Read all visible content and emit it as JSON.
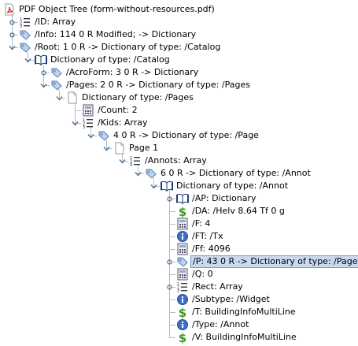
{
  "colors": {
    "tree_line": "#a9c0d8",
    "selection_bg": "#c9d9ee",
    "selection_border": "#7a9cc6"
  },
  "nodes": [
    {
      "label": "PDF Object Tree (form-without-resources.pdf)",
      "icon": "pdf-icon",
      "depth": 0,
      "handle": "none"
    },
    {
      "label": "/ID: Array",
      "icon": "array-icon",
      "depth": 1,
      "handle": "collapsed"
    },
    {
      "label": "/Info: 114 0 R Modified; -> Dictionary",
      "icon": "tag-icon",
      "depth": 1,
      "handle": "collapsed"
    },
    {
      "label": "/Root: 1 0 R -> Dictionary of type: /Catalog",
      "icon": "tag-icon",
      "depth": 1,
      "handle": "expanded"
    },
    {
      "label": "Dictionary of type: /Catalog",
      "icon": "dictionary-icon",
      "depth": 2,
      "handle": "expanded"
    },
    {
      "label": "/AcroForm: 3 0 R -> Dictionary",
      "icon": "tag-icon",
      "depth": 3,
      "handle": "collapsed"
    },
    {
      "label": "/Pages: 2 0 R -> Dictionary of type: /Pages",
      "icon": "tag-icon",
      "depth": 3,
      "handle": "expanded"
    },
    {
      "label": "Dictionary of type: /Pages",
      "icon": "page-icon",
      "depth": 4,
      "handle": "expanded"
    },
    {
      "label": "/Count: 2",
      "icon": "number-icon",
      "depth": 5,
      "handle": "none"
    },
    {
      "label": "/Kids: Array",
      "icon": "array-icon",
      "depth": 5,
      "handle": "expanded"
    },
    {
      "label": "4 0 R -> Dictionary of type: /Page",
      "icon": "tag-icon",
      "depth": 6,
      "handle": "expanded"
    },
    {
      "label": "Page 1",
      "icon": "page-icon",
      "depth": 7,
      "handle": "expanded"
    },
    {
      "label": "/Annots: Array",
      "icon": "array-icon",
      "depth": 8,
      "handle": "expanded"
    },
    {
      "label": "6 0 R -> Dictionary of type: /Annot",
      "icon": "tag-icon",
      "depth": 9,
      "handle": "expanded"
    },
    {
      "label": "Dictionary of type: /Annot",
      "icon": "dictionary-icon",
      "depth": 10,
      "handle": "expanded"
    },
    {
      "label": "/AP: Dictionary",
      "icon": "dictionary-icon",
      "depth": 11,
      "handle": "collapsed"
    },
    {
      "label": "/DA: /Helv 8.64 Tf 0 g",
      "icon": "string-icon",
      "depth": 11,
      "handle": "none"
    },
    {
      "label": "/F: 4",
      "icon": "number-icon",
      "depth": 11,
      "handle": "none"
    },
    {
      "label": "/FT: /Tx",
      "icon": "name-icon",
      "depth": 11,
      "handle": "none"
    },
    {
      "label": "/Ff: 4096",
      "icon": "number-icon",
      "depth": 11,
      "handle": "none"
    },
    {
      "label": "/P: 43 0 R -> Dictionary of type: /Page",
      "icon": "tag-icon",
      "depth": 11,
      "handle": "collapsed",
      "selected": true
    },
    {
      "label": "/Q: 0",
      "icon": "number-icon",
      "depth": 11,
      "handle": "none"
    },
    {
      "label": "/Rect: Array",
      "icon": "array-icon",
      "depth": 11,
      "handle": "collapsed"
    },
    {
      "label": "/Subtype: /Widget",
      "icon": "name-icon",
      "depth": 11,
      "handle": "none"
    },
    {
      "label": "/T: BuildingInfoMultiLine",
      "icon": "string-icon",
      "depth": 11,
      "handle": "none"
    },
    {
      "label": "/Type: /Annot",
      "icon": "name-icon",
      "depth": 11,
      "handle": "none"
    },
    {
      "label": "/V: BuildingInfoMultiLine",
      "icon": "string-icon",
      "depth": 11,
      "handle": "none"
    }
  ]
}
